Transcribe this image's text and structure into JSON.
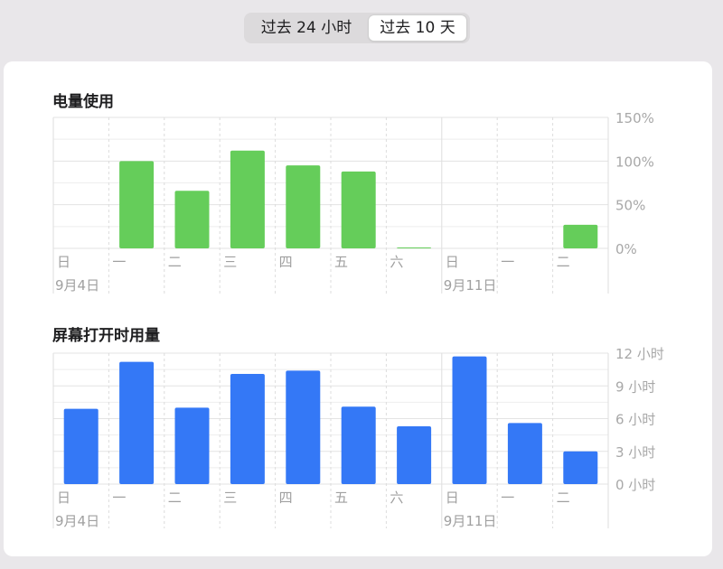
{
  "range_selector": {
    "options": [
      "过去 24 小时",
      "过去 10 天"
    ],
    "selected": "过去 10 天"
  },
  "chart_data": [
    {
      "type": "bar",
      "title": "电量使用",
      "categories": [
        "日",
        "一",
        "二",
        "三",
        "四",
        "五",
        "六",
        "日",
        "一",
        "二"
      ],
      "date_labels": [
        "9月4日",
        "",
        "",
        "",
        "",
        "",
        "",
        "9月11日",
        "",
        ""
      ],
      "values": [
        0,
        100,
        66,
        112,
        95,
        88,
        1,
        0,
        0,
        27
      ],
      "ylim": [
        0,
        150
      ],
      "yticks": [
        0,
        50,
        100,
        150
      ],
      "ytick_labels": [
        "0%",
        "50%",
        "100%",
        "150%"
      ],
      "color": "#65cd5a",
      "grid": true
    },
    {
      "type": "bar",
      "title": "屏幕打开时用量",
      "categories": [
        "日",
        "一",
        "二",
        "三",
        "四",
        "五",
        "六",
        "日",
        "一",
        "二"
      ],
      "date_labels": [
        "9月4日",
        "",
        "",
        "",
        "",
        "",
        "",
        "9月11日",
        "",
        ""
      ],
      "values": [
        6.9,
        11.2,
        7.0,
        10.1,
        10.4,
        7.1,
        5.3,
        11.7,
        5.6,
        3.0
      ],
      "ylim": [
        0,
        12
      ],
      "yticks": [
        0,
        3,
        6,
        9,
        12
      ],
      "ytick_labels": [
        "0 小时",
        "3 小时",
        "6 小时",
        "9 小时",
        "12 小时"
      ],
      "color": "#3478f6",
      "grid": true
    }
  ]
}
